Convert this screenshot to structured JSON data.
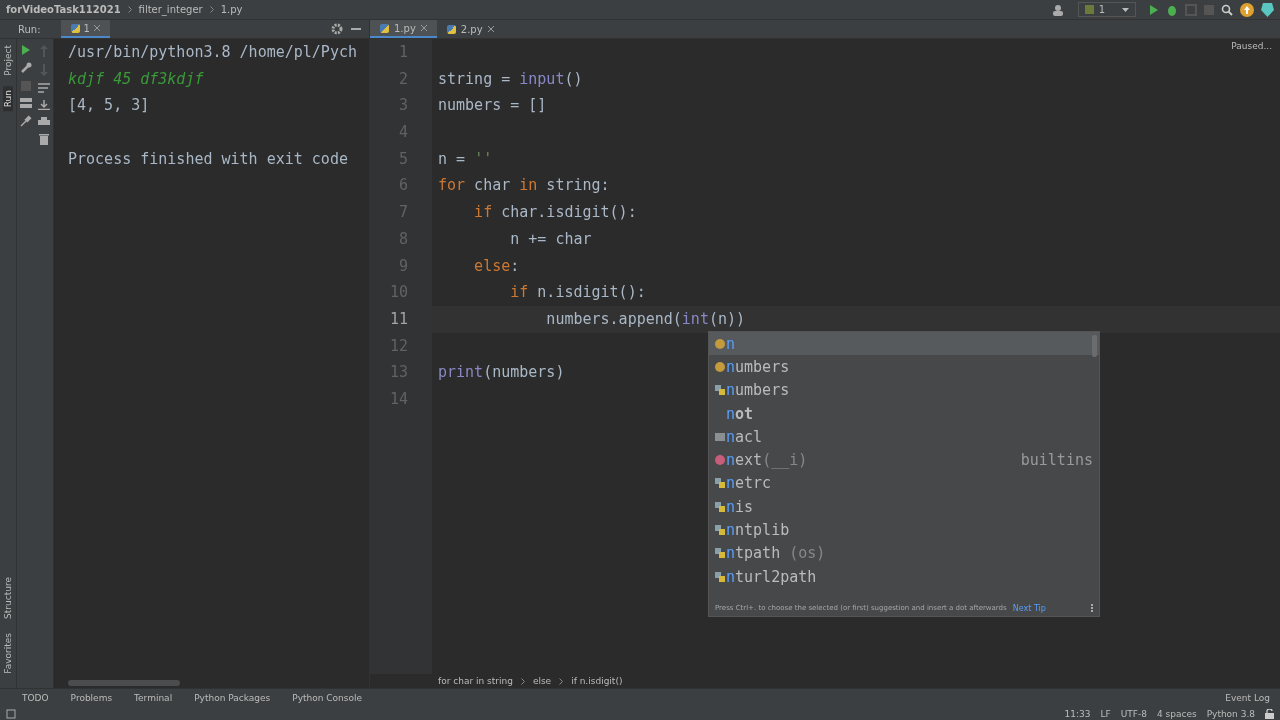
{
  "breadcrumbs": [
    "forVideoTask112021",
    "filter_integer",
    "1.py"
  ],
  "run_config": {
    "label": "1"
  },
  "run_panel": {
    "title": "Run:",
    "tabs": [
      {
        "label": "1",
        "selected": true
      }
    ],
    "console": [
      {
        "kind": "command",
        "text": "/usr/bin/python3.8 /home/pl/Pych"
      },
      {
        "kind": "input",
        "text": "kdjf 45 df3kdjf"
      },
      {
        "kind": "output",
        "text": "[4, 5, 3]"
      },
      {
        "kind": "blank"
      },
      {
        "kind": "output",
        "text": "Process finished with exit code"
      }
    ]
  },
  "side_tabs_left": [
    {
      "label": "Project",
      "selected": false
    },
    {
      "label": "Run",
      "selected": true
    }
  ],
  "side_tabs_bottom": [
    {
      "label": "Structure"
    },
    {
      "label": "Favorites"
    }
  ],
  "editor_tabs": [
    {
      "label": "1.py",
      "selected": true
    },
    {
      "label": "2.py",
      "selected": false
    }
  ],
  "editor_status": "Paused...",
  "code": [
    {
      "number": "1",
      "current": false
    },
    {
      "number": "2",
      "current": false,
      "tokens": [
        {
          "kind": "plain",
          "text": "string = "
        },
        {
          "kind": "builtin",
          "text": "input"
        },
        {
          "kind": "plain",
          "text": "()"
        }
      ]
    },
    {
      "number": "3",
      "current": false,
      "tokens": [
        {
          "kind": "plain",
          "text": "numbers = []"
        }
      ]
    },
    {
      "number": "4",
      "current": false
    },
    {
      "number": "5",
      "current": false,
      "tokens": [
        {
          "kind": "plain",
          "text": "n = "
        },
        {
          "kind": "string",
          "text": "''"
        }
      ]
    },
    {
      "number": "6",
      "current": false,
      "tokens": [
        {
          "kind": "keyword",
          "text": "for"
        },
        {
          "kind": "plain",
          "text": " char "
        },
        {
          "kind": "keyword",
          "text": "in"
        },
        {
          "kind": "plain",
          "text": " string:"
        }
      ],
      "children": [
        {
          "number": "7",
          "current": false,
          "tokens": [
            {
              "kind": "keyword",
              "text": "if"
            },
            {
              "kind": "plain",
              "text": " char.isdigit():"
            }
          ],
          "children": [
            {
              "number": "8",
              "current": false,
              "tokens": [
                {
                  "kind": "plain",
                  "text": "n += char"
                }
              ]
            }
          ]
        },
        {
          "number": "9",
          "current": false,
          "tokens": [
            {
              "kind": "keyword",
              "text": "else"
            },
            {
              "kind": "plain",
              "text": ":"
            }
          ],
          "children": [
            {
              "number": "10",
              "current": false,
              "tokens": [
                {
                  "kind": "keyword",
                  "text": "if"
                },
                {
                  "kind": "plain",
                  "text": " n.isdigit():"
                }
              ],
              "children": [
                {
                  "number": "11",
                  "current": true,
                  "tokens": [
                    {
                      "kind": "plain",
                      "text": "numbers.append("
                    },
                    {
                      "kind": "builtin",
                      "text": "int"
                    },
                    {
                      "kind": "plain",
                      "text": "(n))"
                    }
                  ]
                }
              ]
            }
          ]
        }
      ]
    },
    {
      "number": "12",
      "current": false
    },
    {
      "number": "13",
      "current": false,
      "tokens": [
        {
          "kind": "builtin",
          "text": "print"
        },
        {
          "kind": "plain",
          "text": "(numbers)"
        }
      ]
    },
    {
      "number": "14",
      "current": false
    }
  ],
  "completion": {
    "items": [
      {
        "kind": "variable",
        "match": "n",
        "selected": true
      },
      {
        "kind": "variable",
        "match": "n",
        "rest": "umbers",
        "selected": false
      },
      {
        "kind": "module",
        "match": "n",
        "rest": "umbers",
        "selected": false
      },
      {
        "kind": "keyword",
        "match": "n",
        "rest": "ot",
        "selected": false
      },
      {
        "kind": "package",
        "match": "n",
        "rest": "acl",
        "selected": false
      },
      {
        "kind": "function",
        "match": "n",
        "rest": "ext",
        "args": "(__i)",
        "source": "builtins",
        "selected": false
      },
      {
        "kind": "module",
        "match": "n",
        "rest": "etrc",
        "selected": false
      },
      {
        "kind": "module",
        "match": "n",
        "rest": "is",
        "selected": false
      },
      {
        "kind": "module",
        "match": "n",
        "rest": "ntplib",
        "selected": false
      },
      {
        "kind": "module",
        "match": "n",
        "rest": "tpath",
        "args": " (os)",
        "selected": false
      },
      {
        "kind": "module",
        "match": "n",
        "rest": "turl2path",
        "selected": false
      }
    ],
    "hint": "Press Ctrl+. to choose the selected (or first) suggestion and insert a dot afterwards",
    "hint_link": "Next Tip"
  },
  "code_breadcrumbs": [
    "for char in string",
    "else",
    "if n.isdigit()"
  ],
  "tool_windows": [
    "TODO",
    "Problems",
    "Terminal",
    "Python Packages",
    "Python Console"
  ],
  "event_log": "Event Log",
  "status_bar": [
    "11:33",
    "LF",
    "UTF-8",
    "4 spaces",
    "Python 3.8"
  ]
}
